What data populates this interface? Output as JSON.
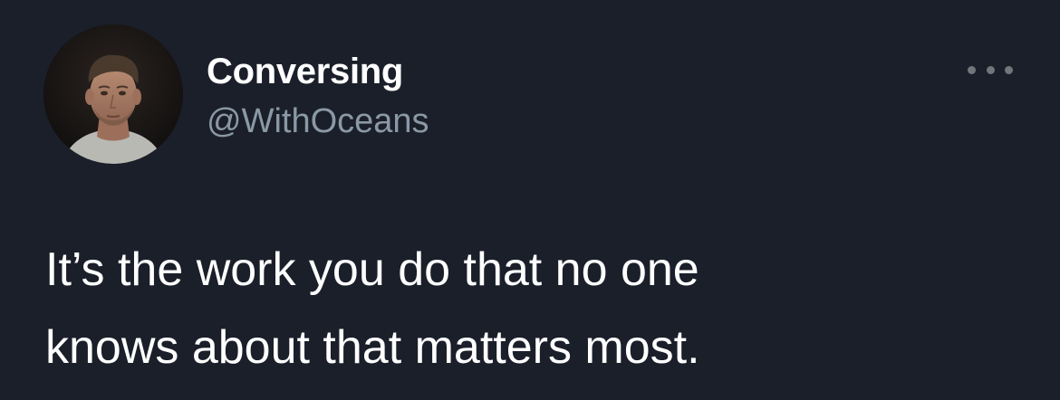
{
  "author": {
    "display_name": "Conversing",
    "handle": "@WithOceans",
    "avatar_icon": "profile-photo-man"
  },
  "menu": {
    "icon": "more-horizontal-icon"
  },
  "tweet": {
    "lines": [
      "It’s the work you do that no one",
      "knows about that matters most."
    ]
  },
  "colors": {
    "background": "#1a1f2a",
    "text_primary": "#ffffff",
    "text_secondary": "#8b98a5",
    "icon_muted": "#71767b"
  }
}
